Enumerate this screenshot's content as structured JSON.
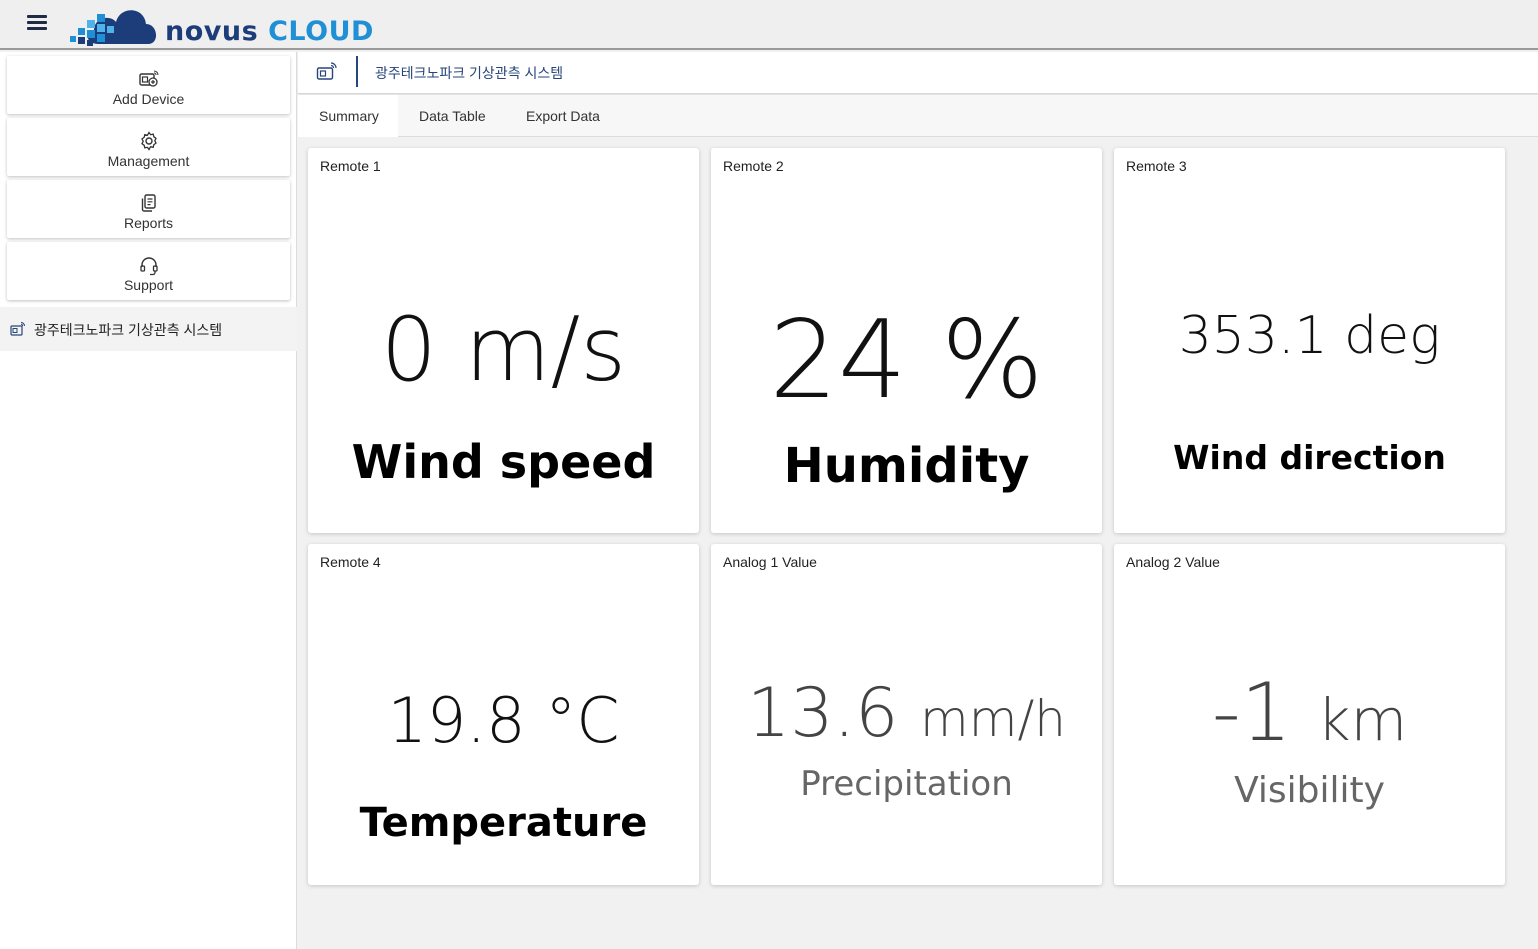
{
  "app": {
    "logo_word1": "novus",
    "logo_word2": "CLOUD",
    "brand_colors": {
      "primary": "#1c3d7a",
      "accent": "#1f8fd6"
    }
  },
  "sidebar": {
    "items": [
      {
        "label": "Add Device",
        "icon": "add-device-icon"
      },
      {
        "label": "Management",
        "icon": "gear-icon"
      },
      {
        "label": "Reports",
        "icon": "reports-icon"
      },
      {
        "label": "Support",
        "icon": "headset-icon"
      }
    ],
    "device": {
      "label": "광주테크노파크 기상관측 시스템",
      "icon": "device-icon"
    }
  },
  "header": {
    "title": "광주테크노파크 기상관측 시스템"
  },
  "tabs": [
    {
      "label": "Summary",
      "active": true
    },
    {
      "label": "Data Table",
      "active": false
    },
    {
      "label": "Export Data",
      "active": false
    }
  ],
  "cards": [
    {
      "title": "Remote 1",
      "value": "0 m/s",
      "name": "Wind speed"
    },
    {
      "title": "Remote 2",
      "value": "24 %",
      "name": "Humidity"
    },
    {
      "title": "Remote 3",
      "value": "353.1 deg",
      "name": "Wind direction"
    },
    {
      "title": "Remote 4",
      "value": "19.8 °C",
      "name": "Temperature"
    },
    {
      "title": "Analog 1 Value",
      "value": "13.6",
      "unit": "mm/h",
      "name": "Precipitation"
    },
    {
      "title": "Analog 2 Value",
      "value": "-1",
      "unit": "km",
      "name": "Visibility"
    }
  ]
}
